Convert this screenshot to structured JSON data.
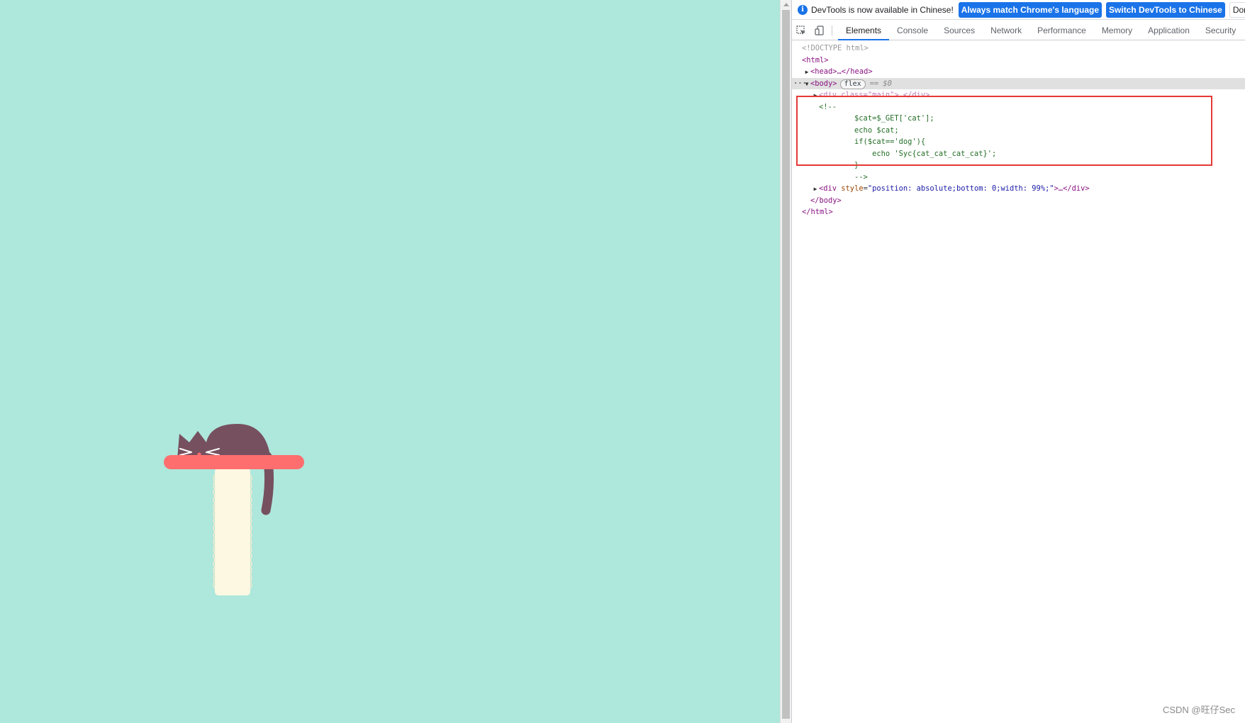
{
  "page": {
    "background_color": "#aee7dc"
  },
  "illustration": {
    "cat_color": "#76505f",
    "shelf_color": "#ff6e6e",
    "post_color": "#fdf8e2"
  },
  "infobar": {
    "message": "DevTools is now available in Chinese!",
    "match_button": "Always match Chrome's language",
    "switch_button": "Switch DevTools to Chinese",
    "dismiss_button": "Don't sho"
  },
  "tabs": [
    {
      "label": "Elements",
      "active": true
    },
    {
      "label": "Console",
      "active": false
    },
    {
      "label": "Sources",
      "active": false
    },
    {
      "label": "Network",
      "active": false
    },
    {
      "label": "Performance",
      "active": false
    },
    {
      "label": "Memory",
      "active": false
    },
    {
      "label": "Application",
      "active": false
    },
    {
      "label": "Security",
      "active": false
    }
  ],
  "dom": {
    "doctype": "<!DOCTYPE html>",
    "html_open": "<html>",
    "head": "<head>…</head>",
    "body_open": "<body>",
    "body_badge": "flex",
    "selected_marker": "== $0",
    "gutter_dots": "···",
    "main_div": "<div class=\"main\">…</div>",
    "comment_lines": [
      "<!--",
      "        $cat=$_GET['cat'];",
      "        echo $cat;",
      "        if($cat=='dog'){",
      "            echo 'Syc{cat_cat_cat_cat}';",
      "        }",
      "        -->"
    ],
    "div2_tag_open": "<div",
    "div2_attr_name": "style",
    "div2_attr_value": "\"position: absolute;bottom: 0;width: 99%;\"",
    "div2_rest": ">…</div>",
    "body_close": "</body>",
    "html_close": "</html>"
  },
  "watermark": "CSDN @旺仔Sec",
  "colors": {
    "accent": "#1a73e8",
    "highlight": "#e53935",
    "comment": "#236e25",
    "tag": "#881280"
  }
}
